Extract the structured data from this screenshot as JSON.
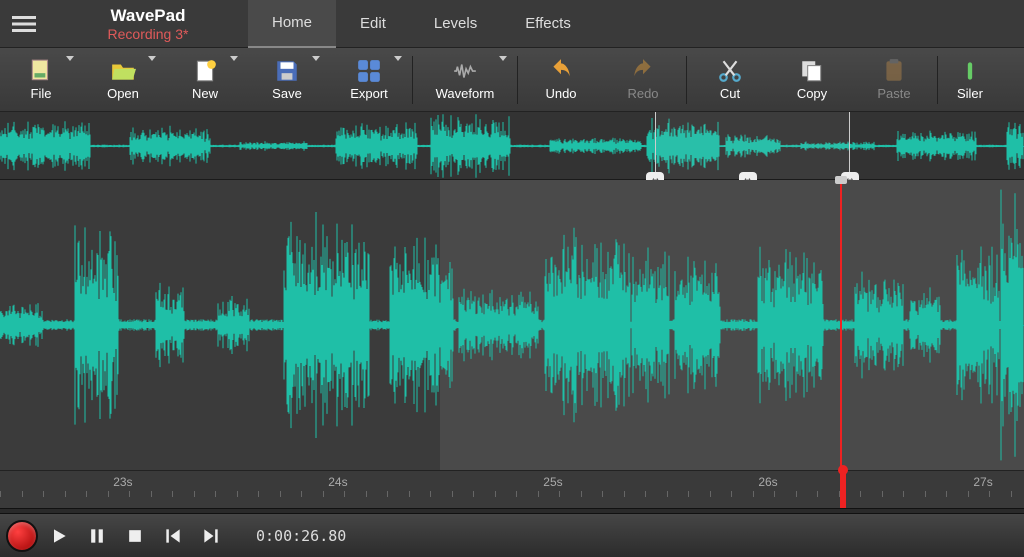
{
  "header": {
    "app_title": "WavePad",
    "project_title": "Recording 3*"
  },
  "tabs": [
    {
      "label": "Home",
      "active": true
    },
    {
      "label": "Edit",
      "active": false
    },
    {
      "label": "Levels",
      "active": false
    },
    {
      "label": "Effects",
      "active": false
    }
  ],
  "toolbar": [
    {
      "label": "File",
      "icon": "file-icon",
      "dropdown": true,
      "disabled": false
    },
    {
      "label": "Open",
      "icon": "open-icon",
      "dropdown": true,
      "disabled": false
    },
    {
      "label": "New",
      "icon": "new-icon",
      "dropdown": true,
      "disabled": false
    },
    {
      "label": "Save",
      "icon": "save-icon",
      "dropdown": true,
      "disabled": false
    },
    {
      "label": "Export",
      "icon": "export-icon",
      "dropdown": true,
      "disabled": false
    },
    {
      "label": "Waveform",
      "icon": "waveform-icon",
      "dropdown": true,
      "disabled": false,
      "wide": true,
      "sep_before": true
    },
    {
      "label": "Undo",
      "icon": "undo-icon",
      "dropdown": false,
      "disabled": false,
      "sep_before": true
    },
    {
      "label": "Redo",
      "icon": "redo-icon",
      "dropdown": false,
      "disabled": true
    },
    {
      "label": "Cut",
      "icon": "cut-icon",
      "dropdown": false,
      "disabled": false,
      "sep_before": true
    },
    {
      "label": "Copy",
      "icon": "copy-icon",
      "dropdown": false,
      "disabled": false
    },
    {
      "label": "Paste",
      "icon": "paste-icon",
      "dropdown": false,
      "disabled": true
    },
    {
      "label": "Silence",
      "icon": "silence-icon",
      "dropdown": false,
      "disabled": false,
      "sep_before": true,
      "truncated": "Siler"
    }
  ],
  "overview": {
    "selection_start_pct": 64,
    "selection_end_pct": 83,
    "handles_pct": [
      64,
      73,
      83
    ]
  },
  "main_wave": {
    "selection_start_pct": 43,
    "selection_end_pct": 100,
    "playhead_pct": 82
  },
  "ruler": {
    "labels": [
      "23s",
      "24s",
      "25s",
      "26s",
      "27s"
    ],
    "positions_pct": [
      12,
      33,
      54,
      75,
      96
    ],
    "play_marker_pct": 82
  },
  "transport": {
    "time": "0:00:26.80"
  },
  "colors": {
    "wave": "#1fbfa7",
    "accent": "#e05a5a",
    "playhead": "#e22222"
  }
}
